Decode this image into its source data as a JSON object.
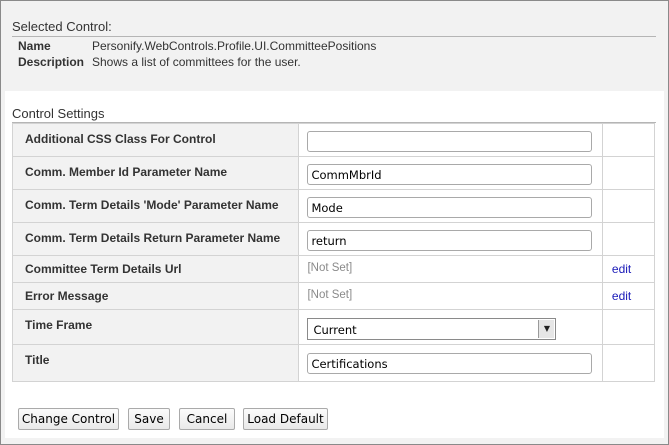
{
  "selected_control": {
    "heading": "Selected Control:",
    "name_label": "Name",
    "name_value": "Personify.WebControls.Profile.UI.CommitteePositions",
    "description_label": "Description",
    "description_value": "Shows a list of committees for the user."
  },
  "control_settings": {
    "heading": "Control Settings",
    "rows": [
      {
        "label": "Additional CSS Class For Control",
        "value": ""
      },
      {
        "label": "Comm. Member Id Parameter Name",
        "value": "CommMbrId"
      },
      {
        "label": "Comm. Term Details 'Mode' Parameter Name",
        "value": "Mode"
      },
      {
        "label": "Comm. Term Details Return Parameter Name",
        "value": "return"
      },
      {
        "label": "Committee Term Details Url",
        "value": "[Not Set]",
        "action": "edit"
      },
      {
        "label": "Error Message",
        "value": "[Not Set]",
        "action": "edit"
      },
      {
        "label": "Time Frame",
        "value": "Current"
      },
      {
        "label": "Title",
        "value": "Certifications"
      }
    ]
  },
  "buttons": {
    "change_control": "Change Control",
    "save": "Save",
    "cancel": "Cancel",
    "load_default": "Load Default"
  },
  "colors": {
    "link": "#1a1ab8",
    "label_bg": "#f2f2f2",
    "not_set_text": "#8a8a8a"
  }
}
